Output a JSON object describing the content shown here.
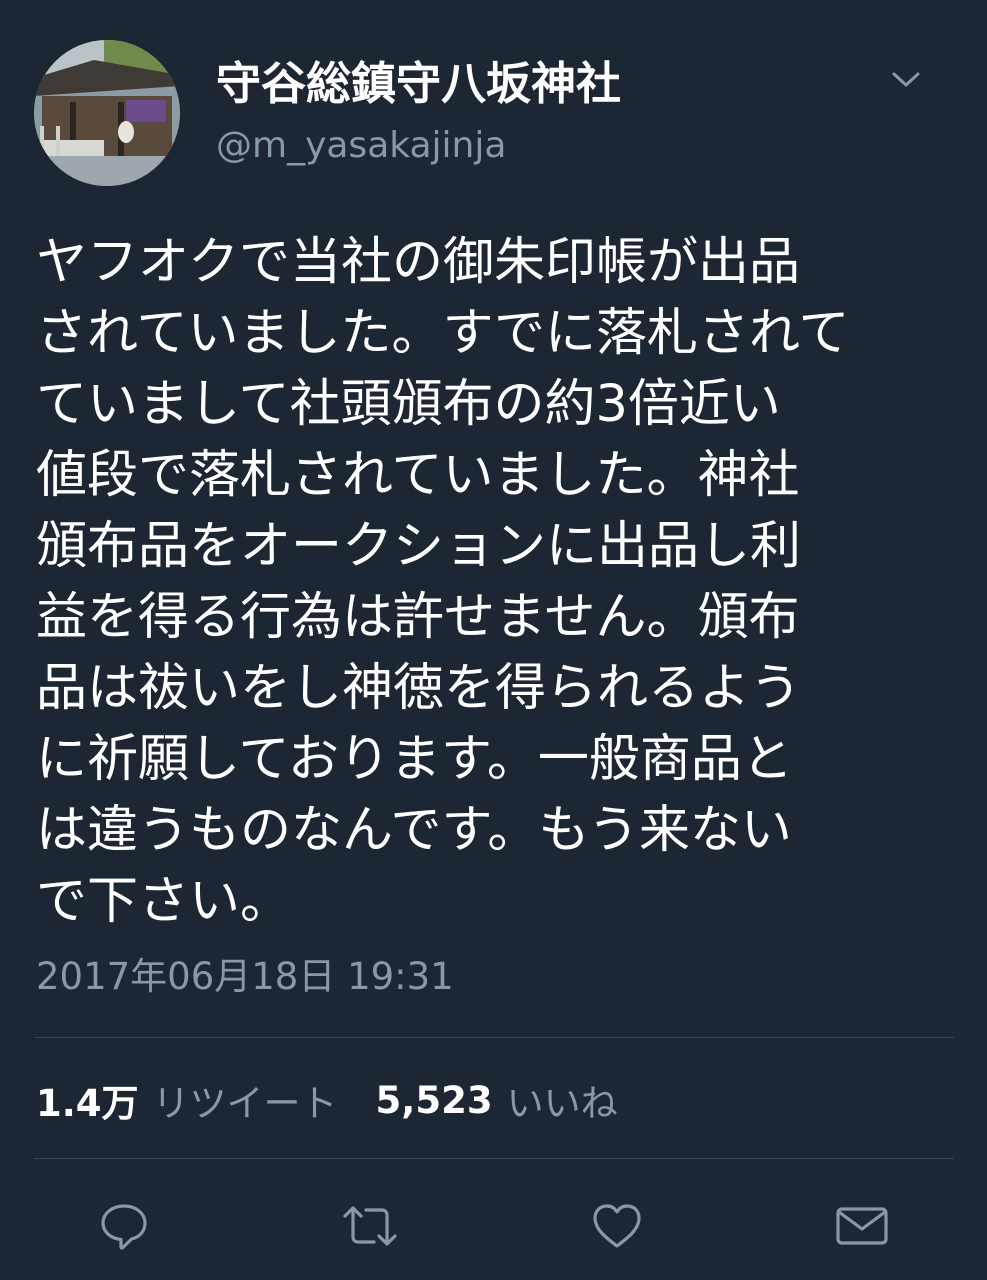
{
  "account": {
    "display_name": "守谷総鎮守八坂神社",
    "handle": "@m_yasakajinja",
    "avatar_icon": "shrine-photo-avatar"
  },
  "header": {
    "menu_icon": "chevron-down-icon"
  },
  "tweet": {
    "lines": [
      "ヤフオクで当社の御朱印帳が出品",
      "されていました。すでに落札されて",
      "ていまして社頭頒布の約3倍近い",
      "値段で落札されていました。神社",
      "頒布品をオークションに出品し利",
      "益を得る行為は許せません。頒布",
      "品は祓いをし神徳を得られるよう",
      "に祈願しております。一般商品と",
      "は違うものなんです。もう来ない",
      "で下さい。"
    ],
    "timestamp": "2017年06月18日 19:31"
  },
  "stats": {
    "retweet_count": "1.4万",
    "retweet_label": "リツイート",
    "like_count": "5,523",
    "like_label": "いいね"
  },
  "actions": {
    "reply_icon": "reply-icon",
    "retweet_icon": "retweet-icon",
    "like_icon": "heart-icon",
    "dm_icon": "envelope-icon"
  },
  "colors": {
    "background": "#1c2733",
    "primary_text": "#ffffff",
    "secondary_text": "#8899a6",
    "divider": "#38444d"
  }
}
